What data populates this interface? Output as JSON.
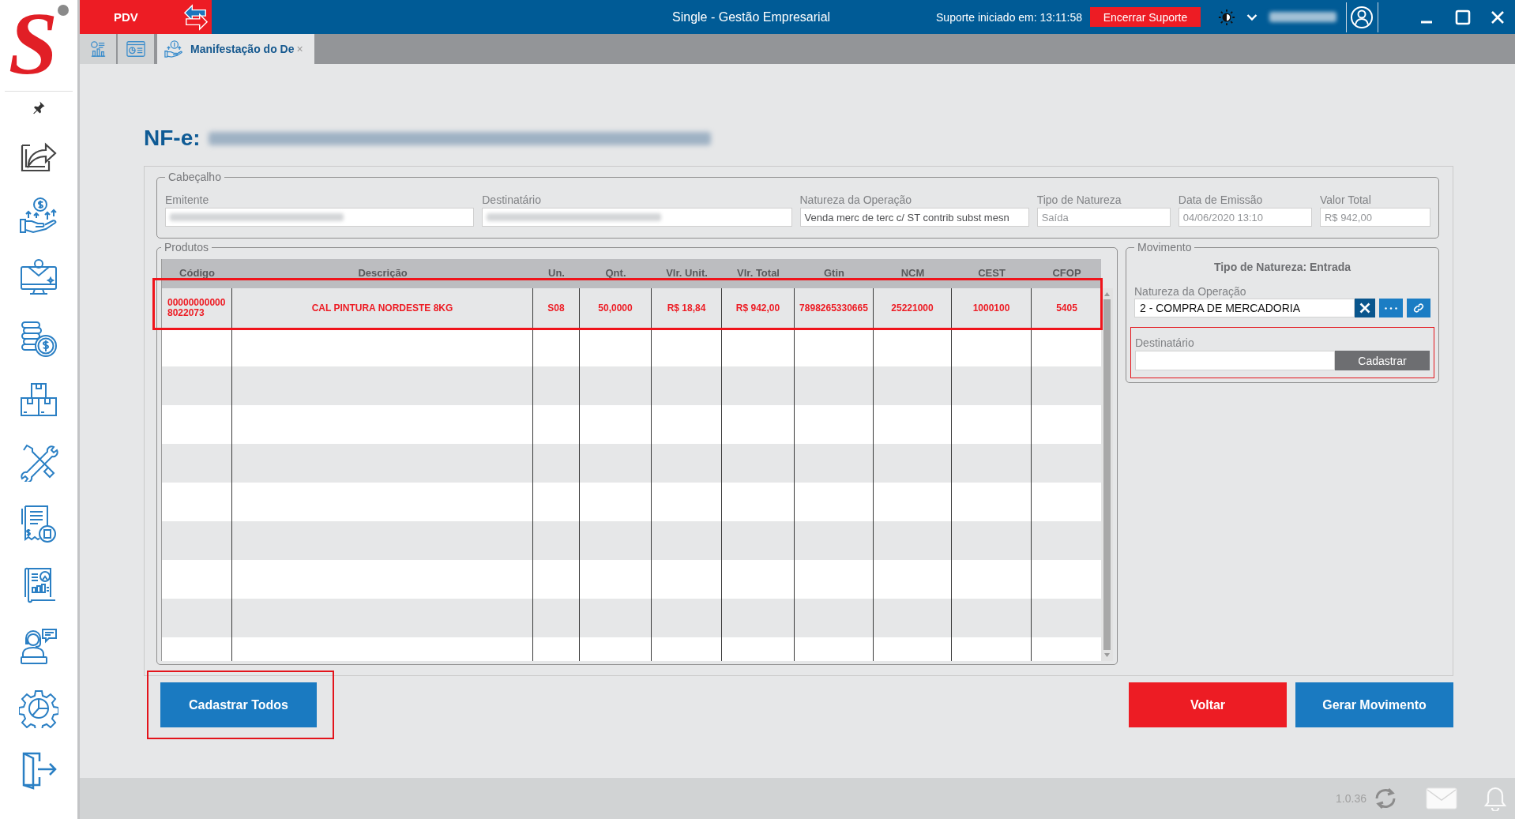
{
  "logo": {
    "letter": "S"
  },
  "app_bar": {
    "pdv_label": "PDV",
    "title": "Single - Gestão Empresarial",
    "support_status": "Suporte iniciado em: 13:11:58",
    "end_support_button": "Encerrar Suporte",
    "user_name_redacted": true
  },
  "tabs": [
    {
      "kind": "report",
      "selected": false
    },
    {
      "kind": "dashboard",
      "selected": false
    },
    {
      "kind": "finance",
      "label": "Manifestação do De",
      "close": "×",
      "selected": true
    }
  ],
  "document": {
    "label": "NF-e:",
    "number_redacted": true
  },
  "header_section": {
    "legend": "Cabeçalho",
    "fields": [
      {
        "label": "Emitente",
        "redacted": true,
        "disabled": true
      },
      {
        "label": "Destinatário",
        "redacted": true,
        "disabled": true
      },
      {
        "label": "Natureza da Operação",
        "value": "Venda merc de terc c/ ST contrib subst mesn",
        "disabled": false
      },
      {
        "label": "Tipo de Natureza",
        "value": "Saída",
        "disabled": true
      },
      {
        "label": "Data de Emissão",
        "value": "04/06/2020 13:10",
        "disabled": true
      },
      {
        "label": "Valor Total",
        "value": "R$ 942,00",
        "disabled": true
      }
    ]
  },
  "products": {
    "legend": "Produtos",
    "columns": [
      "Código",
      "Descrição",
      "Un.",
      "Qnt.",
      "Vlr. Unit.",
      "Vlr. Total",
      "Gtin",
      "NCM",
      "CEST",
      "CFOP"
    ],
    "rows": [
      {
        "cells": [
          "000000000008022073",
          "CAL PINTURA NORDESTE 8KG",
          "S08",
          "50,0000",
          "R$ 18,84",
          "R$ 942,00",
          "7898265330665",
          "25221000",
          "1000100",
          "5405"
        ],
        "not_registered": true,
        "highlighted": true
      }
    ]
  },
  "movement": {
    "legend": "Movimento",
    "nature_type": "Tipo de Natureza: Entrada",
    "operation": {
      "label": "Natureza da Operação",
      "value": "2 - COMPRA DE MERCADORIA"
    },
    "recipient": {
      "label": "Destinatário",
      "button": "Cadastrar",
      "highlighted": true
    }
  },
  "actions": {
    "register_all": {
      "label": "Cadastrar Todos",
      "highlighted": true
    },
    "back": {
      "label": "Voltar"
    },
    "generate": {
      "label": "Gerar Movimento"
    }
  },
  "status_bar": {
    "version": "1.0.36"
  }
}
